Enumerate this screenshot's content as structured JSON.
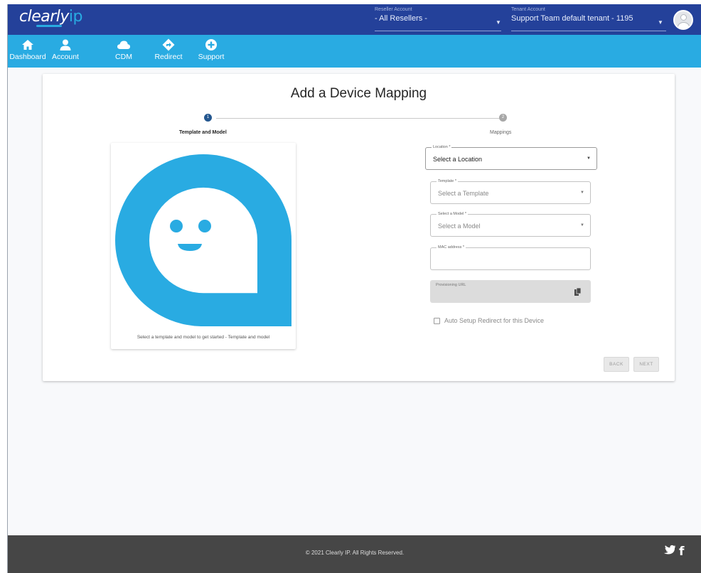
{
  "brand": {
    "logo_main": "clearly",
    "logo_accent": "ip"
  },
  "header": {
    "reseller": {
      "label": "Reseller Account",
      "value": "- All Resellers -"
    },
    "tenant": {
      "label": "Tenant Account",
      "value": "Support Team default tenant - 1195"
    }
  },
  "nav": {
    "items": [
      {
        "label": "Dashboard",
        "icon": "home-icon"
      },
      {
        "label": "Account",
        "icon": "person-icon"
      },
      {
        "label": "CDM",
        "icon": "cloud-icon"
      },
      {
        "label": "Redirect",
        "icon": "diamond-arrow-icon"
      },
      {
        "label": "Support",
        "icon": "plus-circle-icon"
      }
    ]
  },
  "page": {
    "title": "Add a Device Mapping"
  },
  "stepper": {
    "steps": [
      {
        "number": "1",
        "label": "Template and Model",
        "state": "active"
      },
      {
        "number": "2",
        "label": "Mappings",
        "state": "inactive"
      }
    ]
  },
  "preview": {
    "caption": "Select a template and model to get started - Template and model"
  },
  "form": {
    "location": {
      "label": "Location *",
      "value": "Select a Location"
    },
    "template": {
      "label": "Template *",
      "value": "Select a Template"
    },
    "model": {
      "label": "Select a Model *",
      "value": "Select a Model"
    },
    "mac": {
      "label": "MAC address *",
      "value": ""
    },
    "provisioning": {
      "label": "Provisioning URL"
    },
    "auto_redirect": {
      "label": "Auto Setup Redirect for this Device",
      "checked": false
    }
  },
  "buttons": {
    "back": "BACK",
    "next": "NEXT"
  },
  "footer": {
    "copyright": "© 2021 Clearly IP. All Rights Reserved."
  },
  "colors": {
    "header_bg": "#24419a",
    "nav_bg": "#29abe2",
    "accent": "#29abe2",
    "step_active": "#24578f",
    "footer_bg": "#464646"
  }
}
